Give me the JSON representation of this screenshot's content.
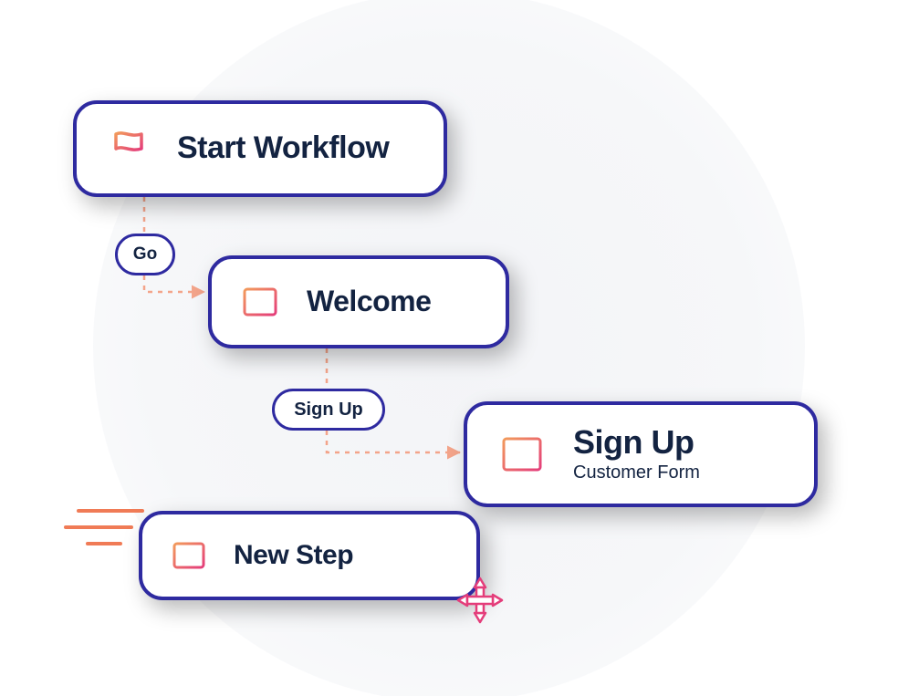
{
  "colors": {
    "border": "#2e2aa0",
    "text": "#132341",
    "connector": "#f3a48a",
    "gradient_from": "#f29a5c",
    "gradient_to": "#e43d7a"
  },
  "nodes": {
    "start": {
      "title": "Start Workflow",
      "icon": "flag-icon"
    },
    "welcome": {
      "title": "Welcome",
      "icon": "window-icon"
    },
    "signup": {
      "title": "Sign Up",
      "subtitle": "Customer Form",
      "icon": "layout-icon"
    },
    "newstep": {
      "title": "New Step",
      "icon": "window-icon"
    }
  },
  "actions": {
    "go": {
      "label": "Go"
    },
    "signup": {
      "label": "Sign Up"
    }
  }
}
